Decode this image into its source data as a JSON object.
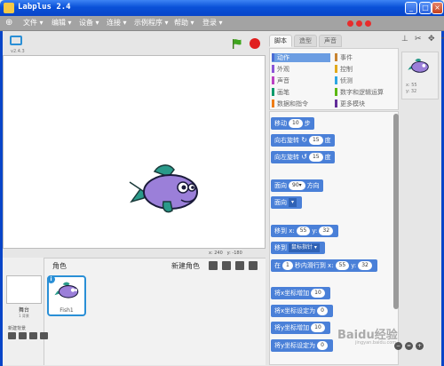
{
  "window": {
    "title": "Labplus 2.4"
  },
  "menu": [
    {
      "label": "文件 ▾"
    },
    {
      "label": "编辑 ▾"
    },
    {
      "label": "设备 ▾"
    },
    {
      "label": "连接 ▾"
    },
    {
      "label": "示例程序 ▾"
    },
    {
      "label": "帮助 ▾"
    },
    {
      "label": "登录 ▾"
    }
  ],
  "stage": {
    "version": "v2.4.3",
    "coords_x": "x: 240",
    "coords_y": "y: -180"
  },
  "sprites": {
    "title": "角色",
    "new_sprite": "新建角色",
    "stage_label": "舞台",
    "stage_sub": "1 背景",
    "new_bg": "新建背景",
    "sprite_name": "Fish1"
  },
  "tabs": [
    "脚本",
    "造型",
    "声音"
  ],
  "categories": {
    "left": [
      {
        "label": "动作",
        "color": "#4a6cd4"
      },
      {
        "label": "外观",
        "color": "#8a55d7"
      },
      {
        "label": "声音",
        "color": "#bb42c3"
      },
      {
        "label": "画笔",
        "color": "#0e9a6c"
      },
      {
        "label": "数据和指令",
        "color": "#ee7d16"
      }
    ],
    "right": [
      {
        "label": "事件",
        "color": "#c88330"
      },
      {
        "label": "控制",
        "color": "#e1a91a"
      },
      {
        "label": "侦测",
        "color": "#2ca5e2"
      },
      {
        "label": "数字和逻辑运算",
        "color": "#5cb712"
      },
      {
        "label": "更多模块",
        "color": "#632d99"
      }
    ]
  },
  "blocks": {
    "move": {
      "a": "移动",
      "n": "10",
      "b": "步"
    },
    "turn_right": {
      "a": "向右旋转",
      "icon": "↻",
      "n": "15",
      "b": "度"
    },
    "turn_left": {
      "a": "向左旋转",
      "icon": "↺",
      "n": "15",
      "b": "度"
    },
    "face": {
      "a": "面向",
      "n": "90▾",
      "b": "方向"
    },
    "face_to": {
      "a": "面向",
      "d": "▾"
    },
    "goto_xy": {
      "a": "移到 x:",
      "x": "55",
      "b": "y:",
      "y": "32"
    },
    "goto": {
      "a": "移到",
      "d": "鼠标指针 ▾"
    },
    "glide": {
      "a": "在",
      "n": "1",
      "b": "秒内滑行到 x:",
      "x": "55",
      "c": "y:",
      "y": "32"
    },
    "change_x": {
      "a": "将x坐标增加",
      "n": "10"
    },
    "set_x": {
      "a": "将x坐标设定为",
      "n": "0"
    },
    "change_y": {
      "a": "将y坐标增加",
      "n": "10"
    },
    "set_y": {
      "a": "将y坐标设定为",
      "n": "0"
    }
  },
  "sprite_info": {
    "x": "x: 55",
    "y": "y: 32"
  },
  "watermark": {
    "main": "Baidu经验",
    "sub": "jingyan.baidu.com"
  }
}
